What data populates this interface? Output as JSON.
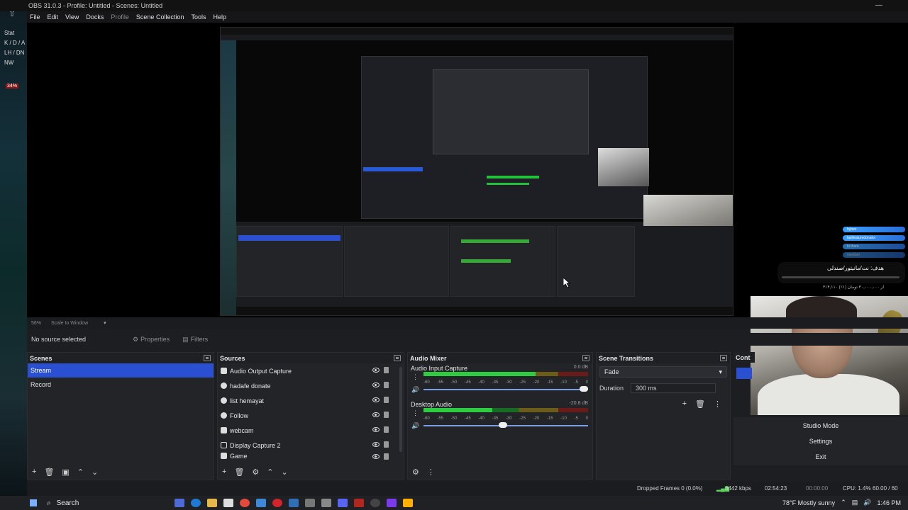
{
  "window": {
    "title": "OBS 31.0.3 - Profile: Untitled - Scenes: Untitled"
  },
  "menu": [
    "File",
    "Edit",
    "View",
    "Docks",
    "Profile",
    "Scene Collection",
    "Tools",
    "Help"
  ],
  "left_overlay": {
    "lines": [
      "Stat",
      "K / D / A",
      "LH / DN",
      "NW"
    ],
    "badge": "34%"
  },
  "preview_status": {
    "zoom": "56%",
    "scale_mode": "Scale to Window"
  },
  "source_toolbar": {
    "no_source": "No source selected",
    "properties": "Properties",
    "filters": "Filters"
  },
  "scenes": {
    "title": "Scenes",
    "items": [
      {
        "label": "Stream",
        "selected": true
      },
      {
        "label": "Record",
        "selected": false
      }
    ]
  },
  "sources": {
    "title": "Sources",
    "items": [
      {
        "label": "Audio Output Capture",
        "icon": "speaker-icon"
      },
      {
        "label": "hadafe donate",
        "icon": "globe-icon"
      },
      {
        "label": "list hemayat",
        "icon": "globe-icon"
      },
      {
        "label": "Follow",
        "icon": "globe-icon"
      },
      {
        "label": "webcam",
        "icon": "camera-icon"
      },
      {
        "label": "Display Capture 2",
        "icon": "monitor-icon"
      },
      {
        "label": "Game",
        "icon": "gamepad-icon"
      }
    ]
  },
  "audio_mixer": {
    "title": "Audio Mixer",
    "channels": [
      {
        "name": "Audio Input Capture",
        "db": "0.0 dB",
        "level": 0.68,
        "volume": 1.0
      },
      {
        "name": "Desktop Audio",
        "db": "-20.8 dB",
        "level": 0.42,
        "volume": 0.48
      }
    ],
    "ticks": [
      "-60",
      "-55",
      "-50",
      "-45",
      "-40",
      "-35",
      "-30",
      "-25",
      "-20",
      "-15",
      "-10",
      "-5",
      "0"
    ]
  },
  "transitions": {
    "title": "Scene Transitions",
    "selected": "Fade",
    "duration_label": "Duration",
    "duration_value": "300 ms"
  },
  "controls": {
    "title": "Cont",
    "studio_mode": "Studio Mode",
    "settings": "Settings",
    "exit": "Exit"
  },
  "status_bar": {
    "dropped": "Dropped Frames 0 (0.0%)",
    "kbps": "3442 kbps",
    "stream_time": "02:54:23",
    "rec_time": "00:00:00",
    "cpu": "CPU: 1.4%",
    "fps": "60.00 / 60"
  },
  "overlay": {
    "goal_title": "هدف: نت/مانیتور/صندلی",
    "goal_sub": "۳۱۴,۱۱۰ از ۳۰,۰۰۰,۰۰۰ تومان (۱٪)",
    "pills": [
      "hybes",
      "lastfeaturedonator",
      "hi there",
      "member"
    ]
  },
  "taskbar": {
    "search": "Search",
    "weather": "78°F  Mostly sunny",
    "time": "1:46 PM"
  },
  "colors": {
    "accent": "#2a50d1",
    "meter_green": "#2ecc40",
    "bg": "#1d1e22"
  }
}
